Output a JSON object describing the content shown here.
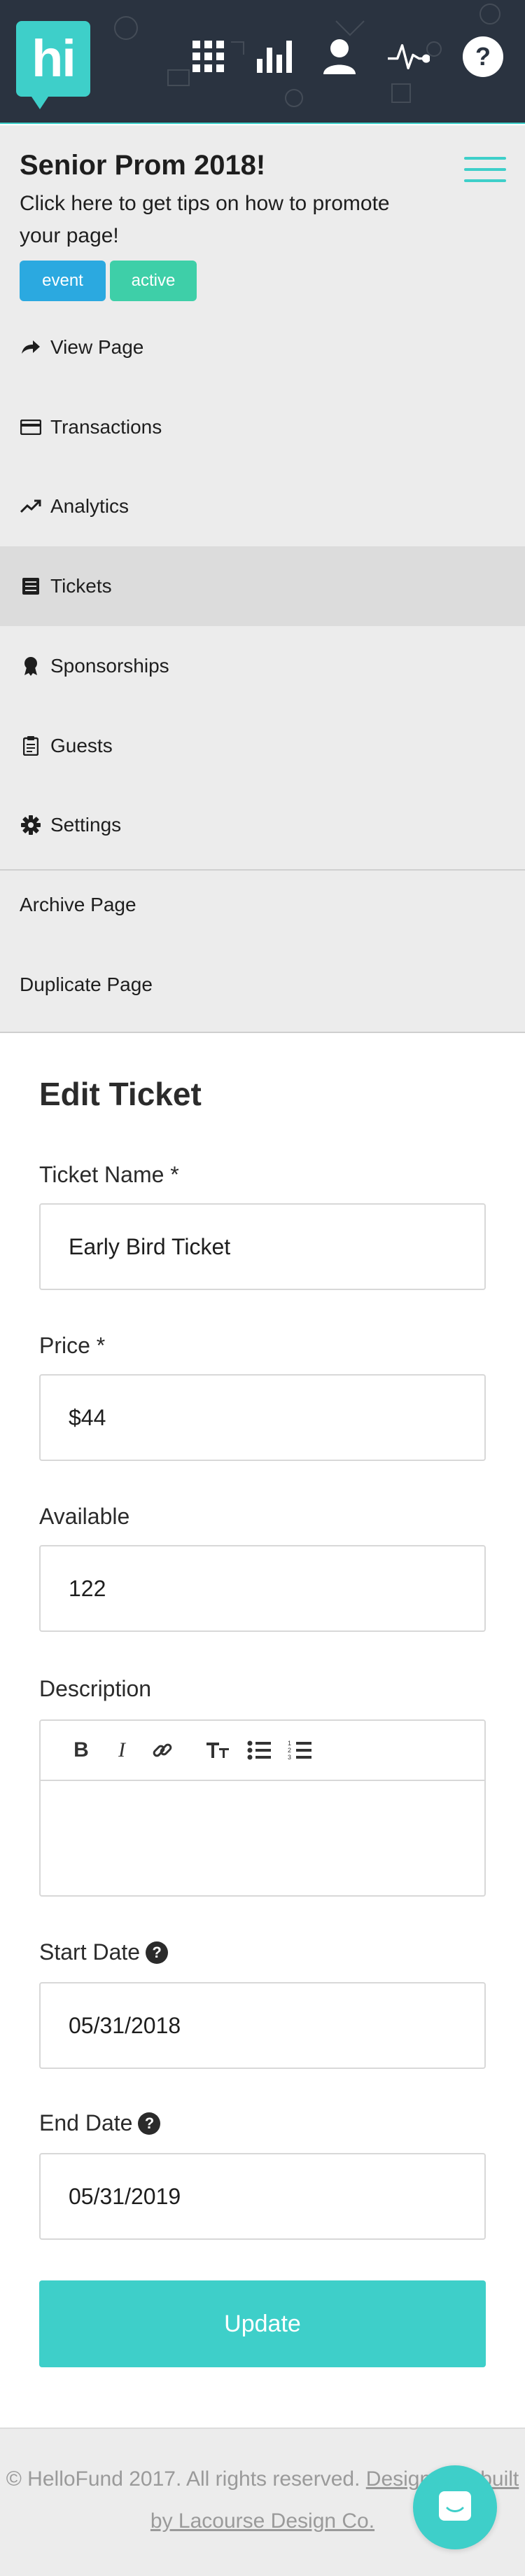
{
  "brand": {
    "logo_text": "hi",
    "accent": "#3ecfc9",
    "navbar_bg": "#2a3340"
  },
  "nav_icons": [
    "apps-grid-icon",
    "bar-chart-icon",
    "user-icon",
    "pulse-icon",
    "help-icon"
  ],
  "page": {
    "title": "Senior Prom 2018!",
    "tips": "Click here to get tips on how to promote your page!",
    "badges": [
      {
        "label": "event",
        "color": "#2ba9e0"
      },
      {
        "label": "active",
        "color": "#3ecfa8"
      }
    ]
  },
  "menu": {
    "items": [
      {
        "label": "View Page",
        "icon": "share-arrow-icon"
      },
      {
        "label": "Transactions",
        "icon": "credit-card-icon"
      },
      {
        "label": "Analytics",
        "icon": "trend-icon"
      },
      {
        "label": "Tickets",
        "icon": "list-icon",
        "active": true
      },
      {
        "label": "Sponsorships",
        "icon": "ribbon-icon"
      },
      {
        "label": "Guests",
        "icon": "clipboard-icon"
      },
      {
        "label": "Settings",
        "icon": "gear-icon"
      }
    ],
    "actions": [
      {
        "label": "Archive Page"
      },
      {
        "label": "Duplicate Page"
      }
    ]
  },
  "form": {
    "title": "Edit Ticket",
    "ticket_name": {
      "label": "Ticket Name *",
      "value": "Early Bird Ticket"
    },
    "price": {
      "label": "Price *",
      "value": "$44"
    },
    "available": {
      "label": "Available",
      "value": "122"
    },
    "description": {
      "label": "Description",
      "value": "",
      "toolbar": [
        "bold-icon",
        "italic-icon",
        "link-icon",
        "text-size-icon",
        "bullet-list-icon",
        "numbered-list-icon"
      ]
    },
    "start_date": {
      "label": "Start Date",
      "value": "05/31/2018"
    },
    "end_date": {
      "label": "End Date",
      "value": "05/31/2019"
    },
    "submit_label": "Update"
  },
  "footer": {
    "text": "© HelloFund 2017. All rights reserved.",
    "link_text": "Designed & built by Lacourse Design Co."
  }
}
